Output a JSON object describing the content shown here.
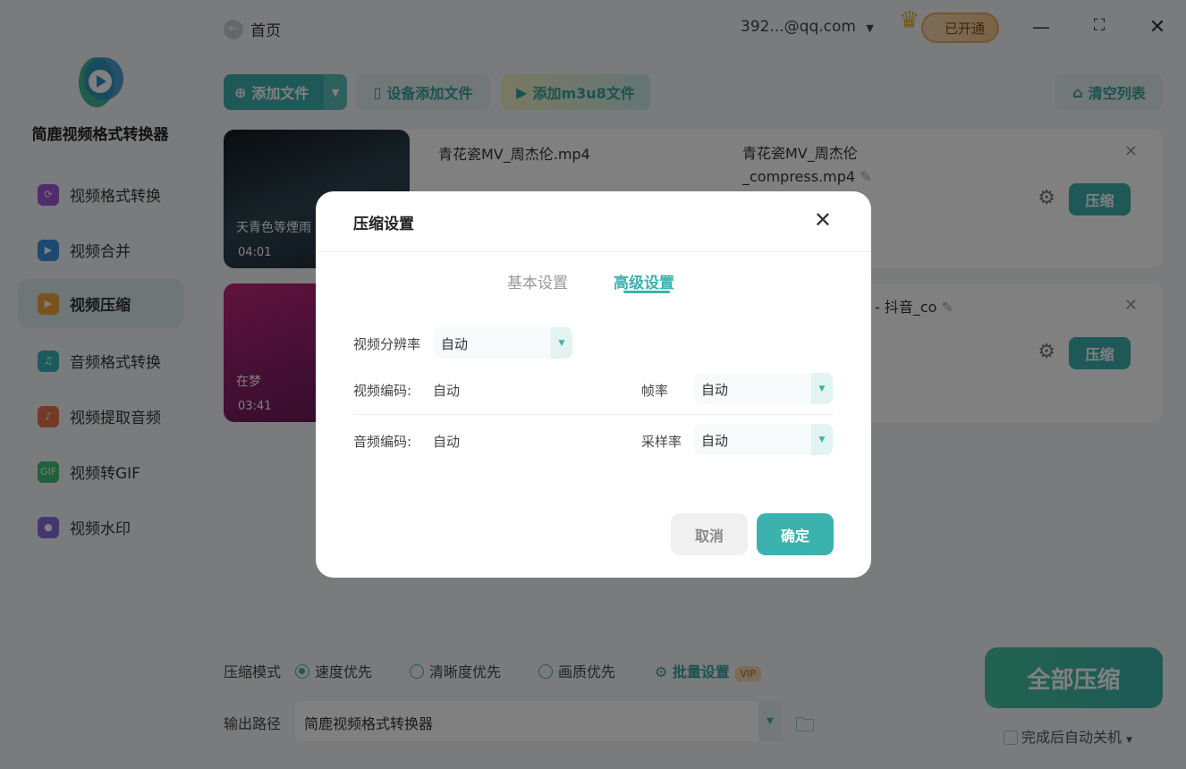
{
  "app": {
    "title": "简鹿视频格式转换器"
  },
  "sidebar": {
    "items": [
      {
        "label": "视频格式转换",
        "color": "#a259d9"
      },
      {
        "label": "视频合并",
        "color": "#3a8fe0"
      },
      {
        "label": "视频压缩",
        "color": "#f3a53a"
      },
      {
        "label": "音频格式转换",
        "color": "#38b6b8"
      },
      {
        "label": "视频提取音频",
        "color": "#e8744f"
      },
      {
        "label": "视频转GIF",
        "color": "#3fbf75"
      },
      {
        "label": "视频水印",
        "color": "#8c6ce0"
      }
    ],
    "active_index": 2
  },
  "topbar": {
    "home": "首页",
    "account": "392...@qq.com",
    "vip_status": "已开通",
    "vip_tag": "VIP"
  },
  "toolbar": {
    "add_file": "添加文件",
    "device_add": "设备添加文件",
    "add_m3u8": "添加m3u8文件",
    "clear_list": "清空列表"
  },
  "files": [
    {
      "name": "青花瓷MV_周杰伦.mp4",
      "output": "青花瓷MV_周杰伦_compress.mp4",
      "duration": "04:01",
      "caption": "天青色等煙雨",
      "action": "压缩"
    },
    {
      "name": "",
      "output": "- 抖音_co",
      "duration": "03:41",
      "caption": "在梦",
      "action": "压缩"
    }
  ],
  "bottom": {
    "mode_label": "压缩模式",
    "modes": [
      "速度优先",
      "清晰度优先",
      "画质优先"
    ],
    "selected_mode": 0,
    "batch": "批量设置",
    "batch_tag": "VIP",
    "output_label": "输出路径",
    "output_path": "简鹿视频格式转换器",
    "compress_all": "全部压缩",
    "auto_shutdown": "完成后自动关机"
  },
  "modal": {
    "title": "压缩设置",
    "tabs": [
      "基本设置",
      "高级设置"
    ],
    "active_tab": 1,
    "resolution_label": "视频分辨率",
    "resolution": "自动",
    "vcodec_label": "视频编码:",
    "vcodec": "自动",
    "fps_label": "帧率",
    "fps": "自动",
    "acodec_label": "音频编码:",
    "acodec": "自动",
    "samplerate_label": "采样率",
    "samplerate": "自动",
    "cancel": "取消",
    "ok": "确定"
  },
  "colors": {
    "accent": "#3bb2ae"
  }
}
